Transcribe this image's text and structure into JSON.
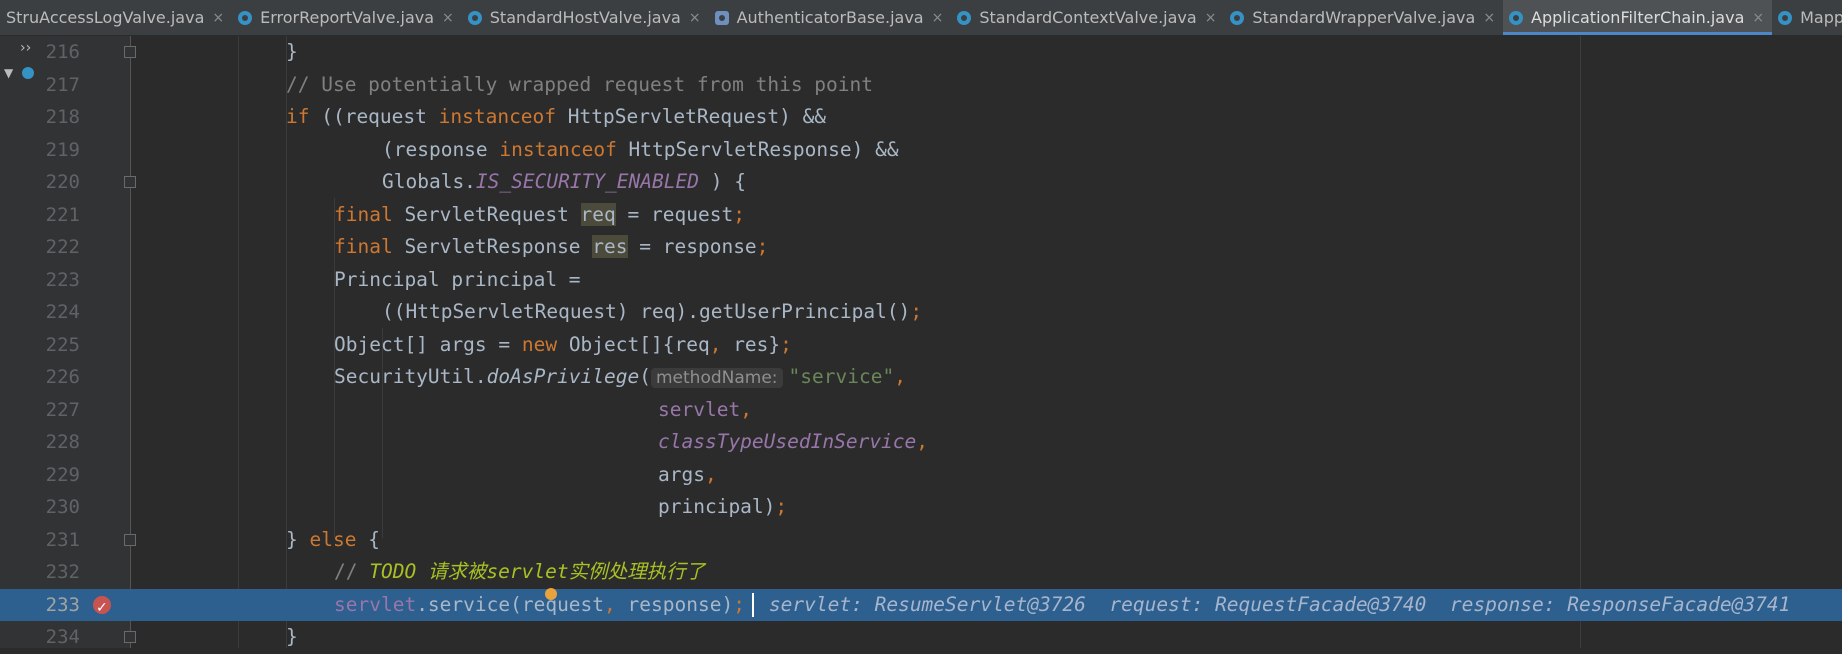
{
  "tabs": [
    {
      "label": "StruAccessLogValve.java",
      "icon": "none",
      "close": "×"
    },
    {
      "label": "ErrorReportValve.java",
      "icon": "class-icon",
      "close": "×"
    },
    {
      "label": "StandardHostValve.java",
      "icon": "class-icon",
      "close": "×"
    },
    {
      "label": "AuthenticatorBase.java",
      "icon": "abstract-class-icon",
      "close": "×"
    },
    {
      "label": "StandardContextValve.java",
      "icon": "class-icon",
      "close": "×"
    },
    {
      "label": "StandardWrapperValve.java",
      "icon": "class-icon",
      "close": "×"
    },
    {
      "label": "ApplicationFilterChain.java",
      "icon": "class-icon",
      "close": "×",
      "active": true
    },
    {
      "label": "Mapper.java",
      "icon": "class-icon",
      "close": "×"
    }
  ],
  "side": {
    "expand": "››",
    "collapse": "▼"
  },
  "lines": {
    "l216": {
      "num": "216",
      "t1": "}"
    },
    "l217": {
      "num": "217",
      "t1": "// Use potentially wrapped request from this point"
    },
    "l218": {
      "num": "218",
      "t1": "if",
      "t2": " ((request ",
      "t3": "instanceof",
      "t4": " HttpServletRequest) &&"
    },
    "l219": {
      "num": "219",
      "t1": "(response ",
      "t2": "instanceof",
      "t3": " HttpServletResponse) &&"
    },
    "l220": {
      "num": "220",
      "t1": "Globals.",
      "t2": "IS_SECURITY_ENABLED",
      "t3": " ) {"
    },
    "l221": {
      "num": "221",
      "t1": "final",
      "t2": " ServletRequest ",
      "t3": "req",
      "t4": " = request",
      "t5": ";"
    },
    "l222": {
      "num": "222",
      "t1": "final",
      "t2": " ServletResponse ",
      "t3": "res",
      "t4": " = response",
      "t5": ";"
    },
    "l223": {
      "num": "223",
      "t1": "Principal principal ="
    },
    "l224": {
      "num": "224",
      "t1": "((HttpServletRequest) req).getUserPrincipal()",
      "t2": ";"
    },
    "l225": {
      "num": "225",
      "t1": "Object[] args = ",
      "t2": "new",
      "t3": " Object[]{req",
      "t4": ",",
      "t5": " res}",
      "t6": ";"
    },
    "l226": {
      "num": "226",
      "t1": "SecurityUtil.",
      "t2": "doAsPrivilege",
      "t3": "(",
      "hint": "methodName:",
      "t4": "\"service\"",
      "t5": ","
    },
    "l227": {
      "num": "227",
      "t1": "servlet",
      "t2": ","
    },
    "l228": {
      "num": "228",
      "t1": "classTypeUsedInService",
      "t2": ","
    },
    "l229": {
      "num": "229",
      "t1": "args",
      "t2": ","
    },
    "l230": {
      "num": "230",
      "t1": "principal)",
      "t2": ";"
    },
    "l231": {
      "num": "231",
      "t1": "} ",
      "t2": "else",
      "t3": " {"
    },
    "l232": {
      "num": "232",
      "t1": "// ",
      "t2": "TODO 请求被servlet实例处理执行了"
    },
    "l233": {
      "num": "233",
      "t1": "servlet",
      "t2": ".service(request",
      "t3": ",",
      "t4": " response)",
      "t5": ";",
      "vals": "servlet: ResumeServlet@3726  request: RequestFacade@3740  response: ResponseFacade@3741"
    },
    "l234": {
      "num": "234",
      "t1": "}"
    }
  }
}
